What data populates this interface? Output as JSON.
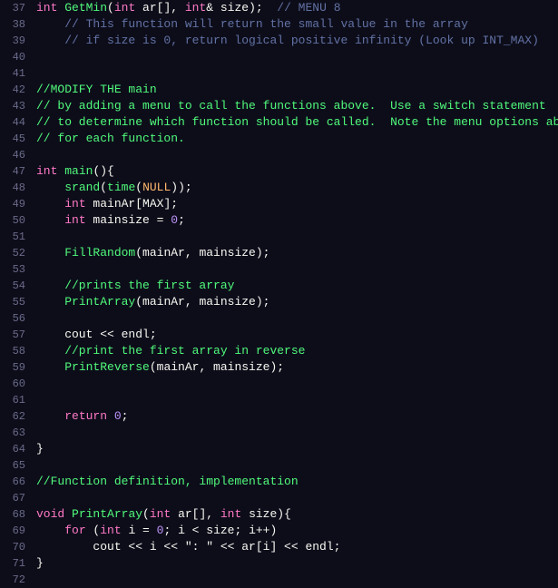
{
  "editor": {
    "background": "#0d0d1a",
    "lines": [
      {
        "num": "37",
        "tokens": [
          {
            "t": "kw",
            "v": "int"
          },
          {
            "t": "plain",
            "v": " "
          },
          {
            "t": "fn",
            "v": "GetMin"
          },
          {
            "t": "plain",
            "v": "("
          },
          {
            "t": "kw",
            "v": "int"
          },
          {
            "t": "plain",
            "v": " ar[], "
          },
          {
            "t": "kw",
            "v": "int"
          },
          {
            "t": "plain",
            "v": "& size);  "
          },
          {
            "t": "cm",
            "v": "// MENU 8"
          }
        ]
      },
      {
        "num": "38",
        "tokens": [
          {
            "t": "cm",
            "v": "    // This function will return the small value in the array"
          }
        ]
      },
      {
        "num": "39",
        "tokens": [
          {
            "t": "cm",
            "v": "    // if size is 0, return logical positive infinity (Look up INT_MAX)"
          }
        ]
      },
      {
        "num": "40",
        "tokens": []
      },
      {
        "num": "41",
        "tokens": []
      },
      {
        "num": "42",
        "tokens": [
          {
            "t": "cm-green",
            "v": "//MODIFY THE main"
          }
        ]
      },
      {
        "num": "43",
        "tokens": [
          {
            "t": "cm-green",
            "v": "// by adding a menu to call the functions above.  Use a switch statement"
          }
        ]
      },
      {
        "num": "44",
        "tokens": [
          {
            "t": "cm-green",
            "v": "// to determine which function should be called.  Note the menu options above"
          }
        ]
      },
      {
        "num": "45",
        "tokens": [
          {
            "t": "cm-green",
            "v": "// for each function."
          }
        ]
      },
      {
        "num": "46",
        "tokens": []
      },
      {
        "num": "47",
        "tokens": [
          {
            "t": "kw",
            "v": "int"
          },
          {
            "t": "plain",
            "v": " "
          },
          {
            "t": "fn",
            "v": "main"
          },
          {
            "t": "plain",
            "v": "(){"
          }
        ]
      },
      {
        "num": "48",
        "tokens": [
          {
            "t": "plain",
            "v": "    "
          },
          {
            "t": "fn",
            "v": "srand"
          },
          {
            "t": "plain",
            "v": "("
          },
          {
            "t": "fn",
            "v": "time"
          },
          {
            "t": "plain",
            "v": "("
          },
          {
            "t": "macro",
            "v": "NULL"
          },
          {
            "t": "plain",
            "v": "));"
          }
        ]
      },
      {
        "num": "49",
        "tokens": [
          {
            "t": "plain",
            "v": "    "
          },
          {
            "t": "kw",
            "v": "int"
          },
          {
            "t": "plain",
            "v": " mainAr[MAX];"
          }
        ]
      },
      {
        "num": "50",
        "tokens": [
          {
            "t": "plain",
            "v": "    "
          },
          {
            "t": "kw",
            "v": "int"
          },
          {
            "t": "plain",
            "v": " mainsize = "
          },
          {
            "t": "num",
            "v": "0"
          },
          {
            "t": "plain",
            "v": ";"
          }
        ]
      },
      {
        "num": "51",
        "tokens": []
      },
      {
        "num": "52",
        "tokens": [
          {
            "t": "plain",
            "v": "    "
          },
          {
            "t": "fn",
            "v": "FillRandom"
          },
          {
            "t": "plain",
            "v": "(mainAr, mainsize);"
          }
        ]
      },
      {
        "num": "53",
        "tokens": []
      },
      {
        "num": "54",
        "tokens": [
          {
            "t": "cm-green",
            "v": "    //prints the first array"
          }
        ]
      },
      {
        "num": "55",
        "tokens": [
          {
            "t": "plain",
            "v": "    "
          },
          {
            "t": "fn",
            "v": "PrintArray"
          },
          {
            "t": "plain",
            "v": "(mainAr, mainsize);"
          }
        ]
      },
      {
        "num": "56",
        "tokens": []
      },
      {
        "num": "57",
        "tokens": [
          {
            "t": "plain",
            "v": "    cout << endl;"
          }
        ]
      },
      {
        "num": "58",
        "tokens": [
          {
            "t": "cm-green",
            "v": "    //print the first array in reverse"
          }
        ]
      },
      {
        "num": "59",
        "tokens": [
          {
            "t": "plain",
            "v": "    "
          },
          {
            "t": "fn",
            "v": "PrintReverse"
          },
          {
            "t": "plain",
            "v": "(mainAr, mainsize);"
          }
        ]
      },
      {
        "num": "60",
        "tokens": []
      },
      {
        "num": "61",
        "tokens": []
      },
      {
        "num": "62",
        "tokens": [
          {
            "t": "plain",
            "v": "    "
          },
          {
            "t": "kw",
            "v": "return"
          },
          {
            "t": "plain",
            "v": " "
          },
          {
            "t": "num",
            "v": "0"
          },
          {
            "t": "plain",
            "v": ";"
          }
        ]
      },
      {
        "num": "63",
        "tokens": []
      },
      {
        "num": "64",
        "tokens": [
          {
            "t": "plain",
            "v": "}"
          }
        ]
      },
      {
        "num": "65",
        "tokens": []
      },
      {
        "num": "66",
        "tokens": [
          {
            "t": "cm-green",
            "v": "//Function definition, implementation"
          }
        ]
      },
      {
        "num": "67",
        "tokens": []
      },
      {
        "num": "68",
        "tokens": [
          {
            "t": "kw",
            "v": "void"
          },
          {
            "t": "plain",
            "v": " "
          },
          {
            "t": "fn",
            "v": "PrintArray"
          },
          {
            "t": "plain",
            "v": "("
          },
          {
            "t": "kw",
            "v": "int"
          },
          {
            "t": "plain",
            "v": " ar[], "
          },
          {
            "t": "kw",
            "v": "int"
          },
          {
            "t": "plain",
            "v": " size){"
          }
        ]
      },
      {
        "num": "69",
        "tokens": [
          {
            "t": "plain",
            "v": "    "
          },
          {
            "t": "kw",
            "v": "for"
          },
          {
            "t": "plain",
            "v": " ("
          },
          {
            "t": "kw",
            "v": "int"
          },
          {
            "t": "plain",
            "v": " i = "
          },
          {
            "t": "num",
            "v": "0"
          },
          {
            "t": "plain",
            "v": "; i < size; i++)"
          }
        ]
      },
      {
        "num": "70",
        "tokens": [
          {
            "t": "plain",
            "v": "        cout << i << \": \" << ar[i] << endl;"
          }
        ]
      },
      {
        "num": "71",
        "tokens": [
          {
            "t": "plain",
            "v": "}"
          }
        ]
      },
      {
        "num": "72",
        "tokens": []
      }
    ]
  }
}
